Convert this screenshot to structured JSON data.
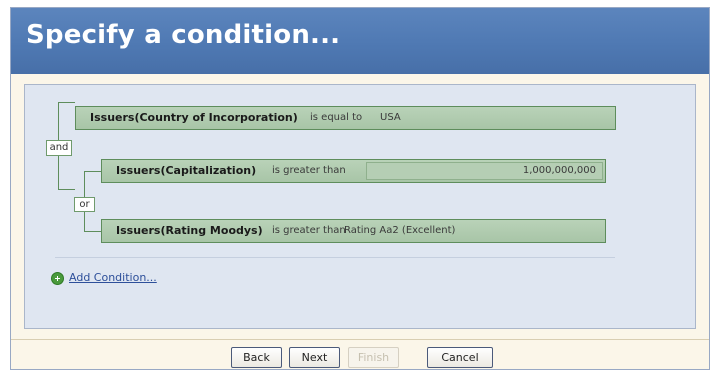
{
  "header": {
    "title": "Specify a condition..."
  },
  "conditions": [
    {
      "field": "Issuers(Country of Incorporation)",
      "operator": "is equal to",
      "value": "USA"
    },
    {
      "field": "Issuers(Capitalization)",
      "operator": "is greater than",
      "value": "1,000,000,000"
    },
    {
      "field": "Issuers(Rating Moodys)",
      "operator": "is greater than",
      "value": "Rating Aa2 (Excellent)"
    }
  ],
  "logic": {
    "and_label": "and",
    "or_label": "or"
  },
  "add_condition": {
    "label": "Add Condition...",
    "icon": "add-circle-icon"
  },
  "buttons": {
    "back": "Back",
    "next": "Next",
    "finish": "Finish",
    "cancel": "Cancel"
  },
  "colors": {
    "header": "#4f79b3",
    "condition_bar": "#a8c5a7",
    "condition_border": "#5e8d5c",
    "content_bg": "#dfe6f1",
    "wizard_bg": "#fbf6e9",
    "link": "#2d4f9a"
  },
  "state": {
    "finish_enabled": false
  }
}
